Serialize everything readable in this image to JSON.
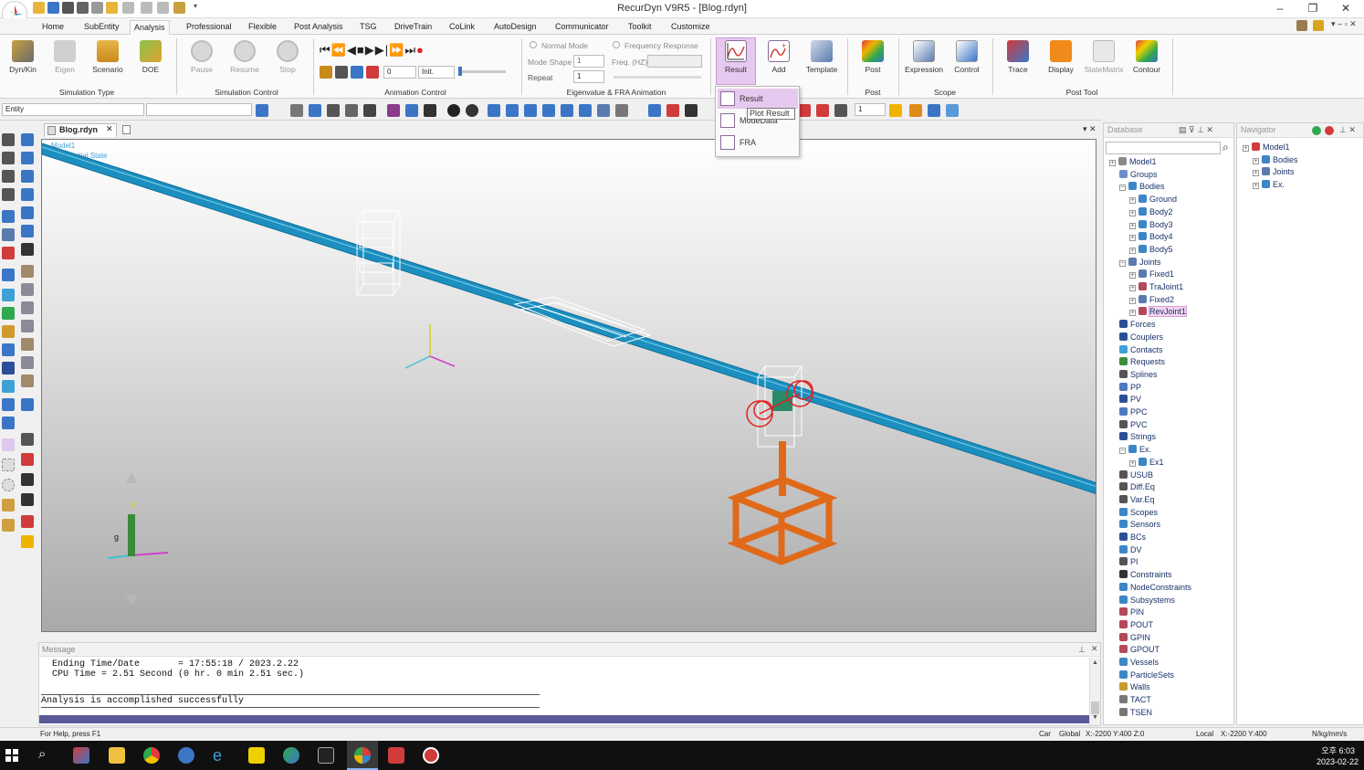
{
  "window": {
    "title": "RecurDyn V9R5  - [Blog.rdyn]",
    "minimize": "‒",
    "restore": "❐",
    "close": "✕"
  },
  "ribbon_tabs": [
    "Home",
    "SubEntity",
    "Analysis",
    "Professional",
    "Flexible",
    "Post Analysis",
    "TSG",
    "DriveTrain",
    "CoLink",
    "AutoDesign",
    "Communicator",
    "Toolkit",
    "Customize"
  ],
  "ribbon": {
    "simulation_type": {
      "label": "Simulation Type",
      "buttons": [
        "Dyn/Kin",
        "Eigen",
        "Scenario",
        "DOE"
      ]
    },
    "simulation_control": {
      "label": "Simulation Control",
      "buttons": [
        "Pause",
        "Resume",
        "Stop"
      ]
    },
    "animation_control": {
      "label": "Animation Control",
      "frame_value": "0",
      "init_label": "Init."
    },
    "eigen": {
      "label": "Eigenvalue & FRA Animation",
      "normal_mode": "Normal Mode",
      "frequency_response": "Frequency Response",
      "mode_shape": "Mode Shape",
      "mode_shape_value": "1",
      "freq_label": "Freq. (HZ)",
      "repeat": "Repeat",
      "repeat_value": "1"
    },
    "result_group": {
      "buttons": [
        "Result",
        "Add",
        "Template"
      ]
    },
    "post": {
      "label": "Post",
      "buttons": [
        "Post"
      ]
    },
    "scope": {
      "label": "Scope",
      "buttons": [
        "Expression",
        "Control"
      ]
    },
    "post_tool": {
      "label": "Post Tool",
      "buttons": [
        "Trace",
        "Display",
        "StateMatrix",
        "Contour"
      ]
    }
  },
  "toolbar2": {
    "entity_value": "Entity",
    "page_value": "1"
  },
  "document_tab": "Blog.rdyn",
  "viewport": {
    "overlay_line1": "Model1",
    "overlay_line2": "Time: Initial State"
  },
  "result_dropdown": {
    "items": [
      "Result",
      "ModeData",
      "FRA"
    ],
    "tooltip": "Plot Result"
  },
  "message_panel": {
    "title": "Message",
    "lines": [
      "  Ending Time/Date       = 17:55:18 / 2023.2.22",
      "  CPU Time = 2.51 Second (0 hr. 0 min 2.51 sec.)",
      "",
      "",
      "Analysis is accomplished successfully"
    ]
  },
  "status_bar": {
    "help": "For Help, press F1",
    "car": "Car",
    "global": "Global",
    "global_coords": "X:-2200 Y:400 Z:0",
    "local": "Local",
    "local_coords": "X:-2200 Y:400",
    "units": "N/kg/mm/s"
  },
  "database": {
    "title": "Database",
    "tree": [
      {
        "label": "Model1",
        "level": 0,
        "color": "#8a8a8a"
      },
      {
        "label": "Groups",
        "level": 1,
        "color": "#6b8ec8"
      },
      {
        "label": "Bodies",
        "level": 1,
        "color": "#3b86c6",
        "expanded": true
      },
      {
        "label": "Ground",
        "level": 2,
        "color": "#3b86c6"
      },
      {
        "label": "Body2",
        "level": 2,
        "color": "#3b86c6"
      },
      {
        "label": "Body3",
        "level": 2,
        "color": "#3b86c6"
      },
      {
        "label": "Body4",
        "level": 2,
        "color": "#3b86c6"
      },
      {
        "label": "Body5",
        "level": 2,
        "color": "#3b86c6"
      },
      {
        "label": "Joints",
        "level": 1,
        "color": "#5a7bb0",
        "expanded": true
      },
      {
        "label": "Fixed1",
        "level": 2,
        "color": "#5a7bb0"
      },
      {
        "label": "TraJoint1",
        "level": 2,
        "color": "#b5485a"
      },
      {
        "label": "Fixed2",
        "level": 2,
        "color": "#5a7bb0"
      },
      {
        "label": "RevJoint1",
        "level": 2,
        "color": "#b5485a",
        "highlight": true
      },
      {
        "label": "Forces",
        "level": 1,
        "color": "#2b4f96"
      },
      {
        "label": "Couplers",
        "level": 1,
        "color": "#2b4f96"
      },
      {
        "label": "Contacts",
        "level": 1,
        "color": "#3fa0d8"
      },
      {
        "label": "Requests",
        "level": 1,
        "color": "#3e8c3e"
      },
      {
        "label": "Splines",
        "level": 1,
        "color": "#555"
      },
      {
        "label": "PP",
        "level": 1,
        "color": "#4d7ac2"
      },
      {
        "label": "PV",
        "level": 1,
        "color": "#2b4f96"
      },
      {
        "label": "PPC",
        "level": 1,
        "color": "#4d7ac2"
      },
      {
        "label": "PVC",
        "level": 1,
        "color": "#555"
      },
      {
        "label": "Strings",
        "level": 1,
        "color": "#2b4f96"
      },
      {
        "label": "Ex.",
        "level": 1,
        "color": "#3b86c6",
        "expanded": true
      },
      {
        "label": "Ex1",
        "level": 2,
        "color": "#3b86c6"
      },
      {
        "label": "USUB",
        "level": 1,
        "color": "#555"
      },
      {
        "label": "Diff.Eq",
        "level": 1,
        "color": "#555"
      },
      {
        "label": "Var.Eq",
        "level": 1,
        "color": "#555"
      },
      {
        "label": "Scopes",
        "level": 1,
        "color": "#3b86c6"
      },
      {
        "label": "Sensors",
        "level": 1,
        "color": "#3b86c6"
      },
      {
        "label": "BCs",
        "level": 1,
        "color": "#2b4f96"
      },
      {
        "label": "DV",
        "level": 1,
        "color": "#3b86c6"
      },
      {
        "label": "PI",
        "level": 1,
        "color": "#555"
      },
      {
        "label": "Constraints",
        "level": 1,
        "color": "#333"
      },
      {
        "label": "NodeConstraints",
        "level": 1,
        "color": "#3b86c6"
      },
      {
        "label": "Subsystems",
        "level": 1,
        "color": "#3b86c6"
      },
      {
        "label": "PIN",
        "level": 1,
        "color": "#b5485a"
      },
      {
        "label": "POUT",
        "level": 1,
        "color": "#b5485a"
      },
      {
        "label": "GPIN",
        "level": 1,
        "color": "#b5485a"
      },
      {
        "label": "GPOUT",
        "level": 1,
        "color": "#b5485a"
      },
      {
        "label": "Vessels",
        "level": 1,
        "color": "#3b86c6"
      },
      {
        "label": "ParticleSets",
        "level": 1,
        "color": "#3b86c6"
      },
      {
        "label": "Walls",
        "level": 1,
        "color": "#c99a2e"
      },
      {
        "label": "TACT",
        "level": 1,
        "color": "#777"
      },
      {
        "label": "TSEN",
        "level": 1,
        "color": "#777"
      }
    ]
  },
  "navigator": {
    "title": "Navigator",
    "tree": [
      {
        "label": "Model1",
        "level": 0,
        "color": "#d03b3b"
      },
      {
        "label": "Bodies",
        "level": 1,
        "color": "#3b86c6"
      },
      {
        "label": "Joints",
        "level": 1,
        "color": "#5a7bb0"
      },
      {
        "label": "Ex.",
        "level": 1,
        "color": "#3b86c6"
      }
    ]
  },
  "taskbar": {
    "time": "오후 6:03",
    "date": "2023-02-22"
  }
}
